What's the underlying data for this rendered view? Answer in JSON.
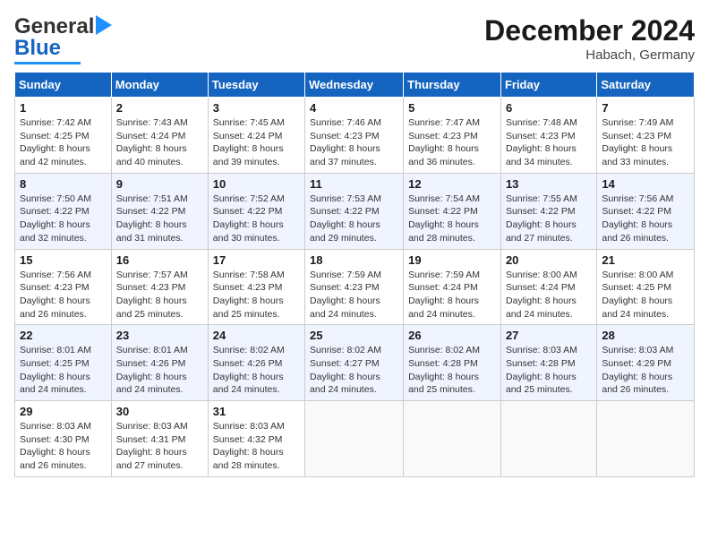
{
  "header": {
    "logo_line1": "General",
    "logo_line2": "Blue",
    "month": "December 2024",
    "location": "Habach, Germany"
  },
  "days_of_week": [
    "Sunday",
    "Monday",
    "Tuesday",
    "Wednesday",
    "Thursday",
    "Friday",
    "Saturday"
  ],
  "weeks": [
    [
      {
        "day": "1",
        "sunrise": "7:42 AM",
        "sunset": "4:25 PM",
        "daylight": "8 hours and 42 minutes."
      },
      {
        "day": "2",
        "sunrise": "7:43 AM",
        "sunset": "4:24 PM",
        "daylight": "8 hours and 40 minutes."
      },
      {
        "day": "3",
        "sunrise": "7:45 AM",
        "sunset": "4:24 PM",
        "daylight": "8 hours and 39 minutes."
      },
      {
        "day": "4",
        "sunrise": "7:46 AM",
        "sunset": "4:23 PM",
        "daylight": "8 hours and 37 minutes."
      },
      {
        "day": "5",
        "sunrise": "7:47 AM",
        "sunset": "4:23 PM",
        "daylight": "8 hours and 36 minutes."
      },
      {
        "day": "6",
        "sunrise": "7:48 AM",
        "sunset": "4:23 PM",
        "daylight": "8 hours and 34 minutes."
      },
      {
        "day": "7",
        "sunrise": "7:49 AM",
        "sunset": "4:23 PM",
        "daylight": "8 hours and 33 minutes."
      }
    ],
    [
      {
        "day": "8",
        "sunrise": "7:50 AM",
        "sunset": "4:22 PM",
        "daylight": "8 hours and 32 minutes."
      },
      {
        "day": "9",
        "sunrise": "7:51 AM",
        "sunset": "4:22 PM",
        "daylight": "8 hours and 31 minutes."
      },
      {
        "day": "10",
        "sunrise": "7:52 AM",
        "sunset": "4:22 PM",
        "daylight": "8 hours and 30 minutes."
      },
      {
        "day": "11",
        "sunrise": "7:53 AM",
        "sunset": "4:22 PM",
        "daylight": "8 hours and 29 minutes."
      },
      {
        "day": "12",
        "sunrise": "7:54 AM",
        "sunset": "4:22 PM",
        "daylight": "8 hours and 28 minutes."
      },
      {
        "day": "13",
        "sunrise": "7:55 AM",
        "sunset": "4:22 PM",
        "daylight": "8 hours and 27 minutes."
      },
      {
        "day": "14",
        "sunrise": "7:56 AM",
        "sunset": "4:22 PM",
        "daylight": "8 hours and 26 minutes."
      }
    ],
    [
      {
        "day": "15",
        "sunrise": "7:56 AM",
        "sunset": "4:23 PM",
        "daylight": "8 hours and 26 minutes."
      },
      {
        "day": "16",
        "sunrise": "7:57 AM",
        "sunset": "4:23 PM",
        "daylight": "8 hours and 25 minutes."
      },
      {
        "day": "17",
        "sunrise": "7:58 AM",
        "sunset": "4:23 PM",
        "daylight": "8 hours and 25 minutes."
      },
      {
        "day": "18",
        "sunrise": "7:59 AM",
        "sunset": "4:23 PM",
        "daylight": "8 hours and 24 minutes."
      },
      {
        "day": "19",
        "sunrise": "7:59 AM",
        "sunset": "4:24 PM",
        "daylight": "8 hours and 24 minutes."
      },
      {
        "day": "20",
        "sunrise": "8:00 AM",
        "sunset": "4:24 PM",
        "daylight": "8 hours and 24 minutes."
      },
      {
        "day": "21",
        "sunrise": "8:00 AM",
        "sunset": "4:25 PM",
        "daylight": "8 hours and 24 minutes."
      }
    ],
    [
      {
        "day": "22",
        "sunrise": "8:01 AM",
        "sunset": "4:25 PM",
        "daylight": "8 hours and 24 minutes."
      },
      {
        "day": "23",
        "sunrise": "8:01 AM",
        "sunset": "4:26 PM",
        "daylight": "8 hours and 24 minutes."
      },
      {
        "day": "24",
        "sunrise": "8:02 AM",
        "sunset": "4:26 PM",
        "daylight": "8 hours and 24 minutes."
      },
      {
        "day": "25",
        "sunrise": "8:02 AM",
        "sunset": "4:27 PM",
        "daylight": "8 hours and 24 minutes."
      },
      {
        "day": "26",
        "sunrise": "8:02 AM",
        "sunset": "4:28 PM",
        "daylight": "8 hours and 25 minutes."
      },
      {
        "day": "27",
        "sunrise": "8:03 AM",
        "sunset": "4:28 PM",
        "daylight": "8 hours and 25 minutes."
      },
      {
        "day": "28",
        "sunrise": "8:03 AM",
        "sunset": "4:29 PM",
        "daylight": "8 hours and 26 minutes."
      }
    ],
    [
      {
        "day": "29",
        "sunrise": "8:03 AM",
        "sunset": "4:30 PM",
        "daylight": "8 hours and 26 minutes."
      },
      {
        "day": "30",
        "sunrise": "8:03 AM",
        "sunset": "4:31 PM",
        "daylight": "8 hours and 27 minutes."
      },
      {
        "day": "31",
        "sunrise": "8:03 AM",
        "sunset": "4:32 PM",
        "daylight": "8 hours and 28 minutes."
      },
      null,
      null,
      null,
      null
    ]
  ],
  "labels": {
    "sunrise": "Sunrise:",
    "sunset": "Sunset:",
    "daylight": "Daylight:"
  }
}
